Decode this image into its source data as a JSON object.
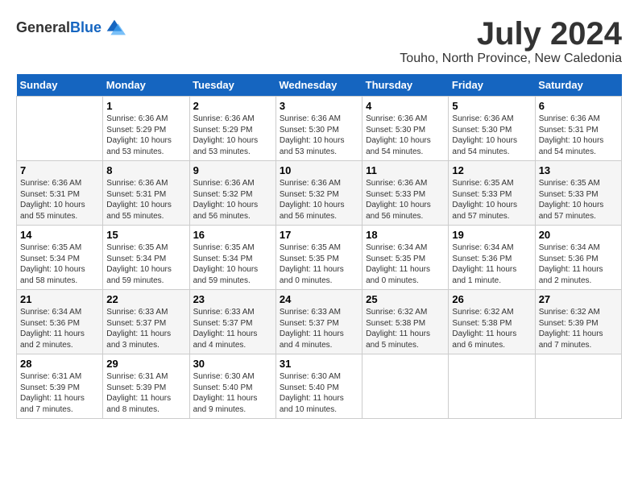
{
  "header": {
    "logo_general": "General",
    "logo_blue": "Blue",
    "month_title": "July 2024",
    "location": "Touho, North Province, New Caledonia"
  },
  "days_of_week": [
    "Sunday",
    "Monday",
    "Tuesday",
    "Wednesday",
    "Thursday",
    "Friday",
    "Saturday"
  ],
  "weeks": [
    [
      {
        "day": "",
        "sunrise": "",
        "sunset": "",
        "daylight": ""
      },
      {
        "day": "1",
        "sunrise": "Sunrise: 6:36 AM",
        "sunset": "Sunset: 5:29 PM",
        "daylight": "Daylight: 10 hours and 53 minutes."
      },
      {
        "day": "2",
        "sunrise": "Sunrise: 6:36 AM",
        "sunset": "Sunset: 5:29 PM",
        "daylight": "Daylight: 10 hours and 53 minutes."
      },
      {
        "day": "3",
        "sunrise": "Sunrise: 6:36 AM",
        "sunset": "Sunset: 5:30 PM",
        "daylight": "Daylight: 10 hours and 53 minutes."
      },
      {
        "day": "4",
        "sunrise": "Sunrise: 6:36 AM",
        "sunset": "Sunset: 5:30 PM",
        "daylight": "Daylight: 10 hours and 54 minutes."
      },
      {
        "day": "5",
        "sunrise": "Sunrise: 6:36 AM",
        "sunset": "Sunset: 5:30 PM",
        "daylight": "Daylight: 10 hours and 54 minutes."
      },
      {
        "day": "6",
        "sunrise": "Sunrise: 6:36 AM",
        "sunset": "Sunset: 5:31 PM",
        "daylight": "Daylight: 10 hours and 54 minutes."
      }
    ],
    [
      {
        "day": "7",
        "sunrise": "Sunrise: 6:36 AM",
        "sunset": "Sunset: 5:31 PM",
        "daylight": "Daylight: 10 hours and 55 minutes."
      },
      {
        "day": "8",
        "sunrise": "Sunrise: 6:36 AM",
        "sunset": "Sunset: 5:31 PM",
        "daylight": "Daylight: 10 hours and 55 minutes."
      },
      {
        "day": "9",
        "sunrise": "Sunrise: 6:36 AM",
        "sunset": "Sunset: 5:32 PM",
        "daylight": "Daylight: 10 hours and 56 minutes."
      },
      {
        "day": "10",
        "sunrise": "Sunrise: 6:36 AM",
        "sunset": "Sunset: 5:32 PM",
        "daylight": "Daylight: 10 hours and 56 minutes."
      },
      {
        "day": "11",
        "sunrise": "Sunrise: 6:36 AM",
        "sunset": "Sunset: 5:33 PM",
        "daylight": "Daylight: 10 hours and 56 minutes."
      },
      {
        "day": "12",
        "sunrise": "Sunrise: 6:35 AM",
        "sunset": "Sunset: 5:33 PM",
        "daylight": "Daylight: 10 hours and 57 minutes."
      },
      {
        "day": "13",
        "sunrise": "Sunrise: 6:35 AM",
        "sunset": "Sunset: 5:33 PM",
        "daylight": "Daylight: 10 hours and 57 minutes."
      }
    ],
    [
      {
        "day": "14",
        "sunrise": "Sunrise: 6:35 AM",
        "sunset": "Sunset: 5:34 PM",
        "daylight": "Daylight: 10 hours and 58 minutes."
      },
      {
        "day": "15",
        "sunrise": "Sunrise: 6:35 AM",
        "sunset": "Sunset: 5:34 PM",
        "daylight": "Daylight: 10 hours and 59 minutes."
      },
      {
        "day": "16",
        "sunrise": "Sunrise: 6:35 AM",
        "sunset": "Sunset: 5:34 PM",
        "daylight": "Daylight: 10 hours and 59 minutes."
      },
      {
        "day": "17",
        "sunrise": "Sunrise: 6:35 AM",
        "sunset": "Sunset: 5:35 PM",
        "daylight": "Daylight: 11 hours and 0 minutes."
      },
      {
        "day": "18",
        "sunrise": "Sunrise: 6:34 AM",
        "sunset": "Sunset: 5:35 PM",
        "daylight": "Daylight: 11 hours and 0 minutes."
      },
      {
        "day": "19",
        "sunrise": "Sunrise: 6:34 AM",
        "sunset": "Sunset: 5:36 PM",
        "daylight": "Daylight: 11 hours and 1 minute."
      },
      {
        "day": "20",
        "sunrise": "Sunrise: 6:34 AM",
        "sunset": "Sunset: 5:36 PM",
        "daylight": "Daylight: 11 hours and 2 minutes."
      }
    ],
    [
      {
        "day": "21",
        "sunrise": "Sunrise: 6:34 AM",
        "sunset": "Sunset: 5:36 PM",
        "daylight": "Daylight: 11 hours and 2 minutes."
      },
      {
        "day": "22",
        "sunrise": "Sunrise: 6:33 AM",
        "sunset": "Sunset: 5:37 PM",
        "daylight": "Daylight: 11 hours and 3 minutes."
      },
      {
        "day": "23",
        "sunrise": "Sunrise: 6:33 AM",
        "sunset": "Sunset: 5:37 PM",
        "daylight": "Daylight: 11 hours and 4 minutes."
      },
      {
        "day": "24",
        "sunrise": "Sunrise: 6:33 AM",
        "sunset": "Sunset: 5:37 PM",
        "daylight": "Daylight: 11 hours and 4 minutes."
      },
      {
        "day": "25",
        "sunrise": "Sunrise: 6:32 AM",
        "sunset": "Sunset: 5:38 PM",
        "daylight": "Daylight: 11 hours and 5 minutes."
      },
      {
        "day": "26",
        "sunrise": "Sunrise: 6:32 AM",
        "sunset": "Sunset: 5:38 PM",
        "daylight": "Daylight: 11 hours and 6 minutes."
      },
      {
        "day": "27",
        "sunrise": "Sunrise: 6:32 AM",
        "sunset": "Sunset: 5:39 PM",
        "daylight": "Daylight: 11 hours and 7 minutes."
      }
    ],
    [
      {
        "day": "28",
        "sunrise": "Sunrise: 6:31 AM",
        "sunset": "Sunset: 5:39 PM",
        "daylight": "Daylight: 11 hours and 7 minutes."
      },
      {
        "day": "29",
        "sunrise": "Sunrise: 6:31 AM",
        "sunset": "Sunset: 5:39 PM",
        "daylight": "Daylight: 11 hours and 8 minutes."
      },
      {
        "day": "30",
        "sunrise": "Sunrise: 6:30 AM",
        "sunset": "Sunset: 5:40 PM",
        "daylight": "Daylight: 11 hours and 9 minutes."
      },
      {
        "day": "31",
        "sunrise": "Sunrise: 6:30 AM",
        "sunset": "Sunset: 5:40 PM",
        "daylight": "Daylight: 11 hours and 10 minutes."
      },
      {
        "day": "",
        "sunrise": "",
        "sunset": "",
        "daylight": ""
      },
      {
        "day": "",
        "sunrise": "",
        "sunset": "",
        "daylight": ""
      },
      {
        "day": "",
        "sunrise": "",
        "sunset": "",
        "daylight": ""
      }
    ]
  ]
}
